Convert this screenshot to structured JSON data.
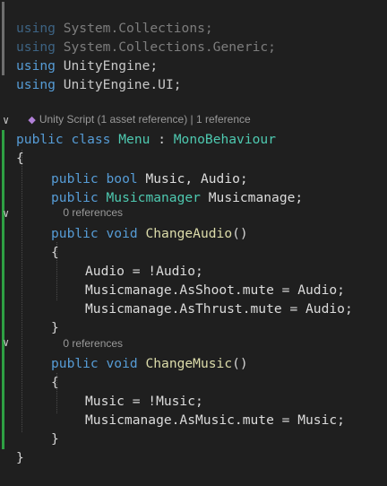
{
  "usings": [
    {
      "kw": "using",
      "rest": "System.Collections;"
    },
    {
      "kw": "using",
      "rest": "System.Collections.Generic;"
    },
    {
      "kw": "using",
      "rest": "UnityEngine;"
    },
    {
      "kw": "using",
      "rest": "UnityEngine.UI;"
    }
  ],
  "codelens": {
    "class_refs": "Unity Script (1 asset reference) | 1 reference",
    "change_audio_refs": "0 references",
    "change_music_refs": "0 references"
  },
  "class_decl": {
    "kw1": "public",
    "kw2": "class",
    "name": "Menu",
    "sep": " : ",
    "base": "MonoBehaviour"
  },
  "open_brace": "{",
  "close_brace": "}",
  "fields": {
    "line1": {
      "kw1": "public",
      "kw2": "bool",
      "rest": "Music, Audio;"
    },
    "line2": {
      "kw1": "public",
      "type": "Musicmanager",
      "rest": "Musicmanage;"
    }
  },
  "change_audio": {
    "kw1": "public",
    "kw2": "void",
    "name": "ChangeAudio",
    "parens": "()",
    "open": "{",
    "body": [
      "Audio = !Audio;",
      "Musicmanage.AsShoot.mute = Audio;",
      "Musicmanage.AsThrust.mute = Audio;"
    ],
    "close": "}"
  },
  "change_music": {
    "kw1": "public",
    "kw2": "void",
    "name": "ChangeMusic",
    "parens": "()",
    "open": "{",
    "body": [
      "Music = !Music;",
      "Musicmanage.AsMusic.mute = Music;"
    ],
    "close": "}"
  }
}
